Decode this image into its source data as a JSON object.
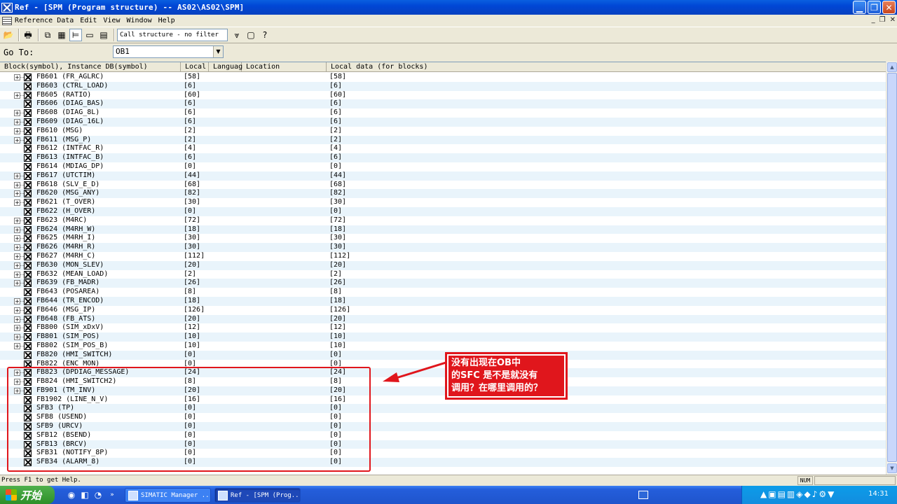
{
  "window": {
    "title": "Ref - [SPM (Program structure) -- AS02\\AS02\\SPM]"
  },
  "menu": {
    "items": [
      "Reference Data",
      "Edit",
      "View",
      "Window",
      "Help"
    ]
  },
  "toolbar": {
    "filter_value": "Call structure - no filter"
  },
  "goto": {
    "label": "Go To:",
    "value": "OB1"
  },
  "table": {
    "columns": [
      "Block(symbol), Instance DB(symbol)",
      "Local",
      "Languag",
      "Location",
      "Local data (for blocks)"
    ],
    "rows": [
      {
        "name": "FB601 (FR_AGLRC)",
        "local": "[58]",
        "ld": "[58]",
        "exp": true
      },
      {
        "name": "FB603 (CTRL_LOAD)",
        "local": "[6]",
        "ld": "[6]",
        "exp": false
      },
      {
        "name": "FB605 (RATIO)",
        "local": "[60]",
        "ld": "[60]",
        "exp": true
      },
      {
        "name": "FB606 (DIAG_BAS)",
        "local": "[6]",
        "ld": "[6]",
        "exp": false
      },
      {
        "name": "FB608 (DIAG_8L)",
        "local": "[6]",
        "ld": "[6]",
        "exp": true
      },
      {
        "name": "FB609 (DIAG_16L)",
        "local": "[6]",
        "ld": "[6]",
        "exp": true
      },
      {
        "name": "FB610 (MSG)",
        "local": "[2]",
        "ld": "[2]",
        "exp": true
      },
      {
        "name": "FB611 (MSG_P)",
        "local": "[2]",
        "ld": "[2]",
        "exp": true
      },
      {
        "name": "FB612 (INTFAC_R)",
        "local": "[4]",
        "ld": "[4]",
        "exp": false
      },
      {
        "name": "FB613 (INTFAC_B)",
        "local": "[6]",
        "ld": "[6]",
        "exp": false
      },
      {
        "name": "FB614 (MDIAG_DP)",
        "local": "[0]",
        "ld": "[0]",
        "exp": false
      },
      {
        "name": "FB617 (UTCTIM)",
        "local": "[44]",
        "ld": "[44]",
        "exp": true
      },
      {
        "name": "FB618 (SLV_E_D)",
        "local": "[68]",
        "ld": "[68]",
        "exp": true
      },
      {
        "name": "FB620 (MSG_ANY)",
        "local": "[82]",
        "ld": "[82]",
        "exp": true
      },
      {
        "name": "FB621 (T_OVER)",
        "local": "[30]",
        "ld": "[30]",
        "exp": true
      },
      {
        "name": "FB622 (H_OVER)",
        "local": "[0]",
        "ld": "[0]",
        "exp": false
      },
      {
        "name": "FB623 (M4RC)",
        "local": "[72]",
        "ld": "[72]",
        "exp": true
      },
      {
        "name": "FB624 (M4RH_W)",
        "local": "[18]",
        "ld": "[18]",
        "exp": true
      },
      {
        "name": "FB625 (M4RH_I)",
        "local": "[30]",
        "ld": "[30]",
        "exp": true
      },
      {
        "name": "FB626 (M4RH_R)",
        "local": "[30]",
        "ld": "[30]",
        "exp": true
      },
      {
        "name": "FB627 (M4RH_C)",
        "local": "[112]",
        "ld": "[112]",
        "exp": true
      },
      {
        "name": "FB630 (MON_SLEV)",
        "local": "[20]",
        "ld": "[20]",
        "exp": true
      },
      {
        "name": "FB632 (MEAN_LOAD)",
        "local": "[2]",
        "ld": "[2]",
        "exp": true
      },
      {
        "name": "FB639 (FB_MADR)",
        "local": "[26]",
        "ld": "[26]",
        "exp": true
      },
      {
        "name": "FB643 (POSAREA)",
        "local": "[8]",
        "ld": "[8]",
        "exp": false
      },
      {
        "name": "FB644 (TR_ENCOD)",
        "local": "[18]",
        "ld": "[18]",
        "exp": true
      },
      {
        "name": "FB646 (MSG_IP)",
        "local": "[126]",
        "ld": "[126]",
        "exp": true
      },
      {
        "name": "FB648 (FB_ATS)",
        "local": "[20]",
        "ld": "[20]",
        "exp": true
      },
      {
        "name": "FB800 (SIM_xDxV)",
        "local": "[12]",
        "ld": "[12]",
        "exp": true
      },
      {
        "name": "FB801 (SIM_POS)",
        "local": "[10]",
        "ld": "[10]",
        "exp": true
      },
      {
        "name": "FB802 (SIM_POS_B)",
        "local": "[10]",
        "ld": "[10]",
        "exp": true
      },
      {
        "name": "FB820 (HMI_SWITCH)",
        "local": "[0]",
        "ld": "[0]",
        "exp": false
      },
      {
        "name": "FB822 (ENC_MON)",
        "local": "[0]",
        "ld": "[0]",
        "exp": false
      },
      {
        "name": "FB823 (DPDIAG_MESSAGE)",
        "local": "[24]",
        "ld": "[24]",
        "exp": true
      },
      {
        "name": "FB824 (HMI_SWITCH2)",
        "local": "[8]",
        "ld": "[8]",
        "exp": true
      },
      {
        "name": "FB901 (TM_INV)",
        "local": "[20]",
        "ld": "[20]",
        "exp": true
      },
      {
        "name": "FB1902 (LINE_N_V)",
        "local": "[16]",
        "ld": "[16]",
        "exp": false
      },
      {
        "name": "SFB3 (TP)",
        "local": "[0]",
        "ld": "[0]",
        "exp": false
      },
      {
        "name": "SFB8 (USEND)",
        "local": "[0]",
        "ld": "[0]",
        "exp": false
      },
      {
        "name": "SFB9 (URCV)",
        "local": "[0]",
        "ld": "[0]",
        "exp": false
      },
      {
        "name": "SFB12 (BSEND)",
        "local": "[0]",
        "ld": "[0]",
        "exp": false
      },
      {
        "name": "SFB13 (BRCV)",
        "local": "[0]",
        "ld": "[0]",
        "exp": false
      },
      {
        "name": "SFB31 (NOTIFY_8P)",
        "local": "[0]",
        "ld": "[0]",
        "exp": false
      },
      {
        "name": "SFB34 (ALARM_8)",
        "local": "[0]",
        "ld": "[0]",
        "exp": false
      }
    ]
  },
  "status": {
    "message": "Press F1 to get Help.",
    "num": "NUM"
  },
  "taskbar": {
    "start_label": "开始",
    "tasks": [
      "SIMATIC Manager ...",
      "Ref - [SPM (Prog..."
    ],
    "clock": "14:31"
  },
  "annotation": {
    "line1": "没有出现在OB中",
    "line2": "的SFC 是不是就没有",
    "line3": "调用？在哪里调用的？"
  },
  "colors": {
    "annotation_red": "#e0161c",
    "row_alt": "#e9f4fb",
    "titlebar_blue": "#0046d5"
  }
}
